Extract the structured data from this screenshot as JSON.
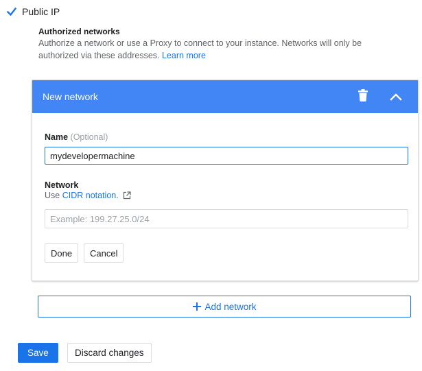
{
  "public_ip": {
    "label": "Public IP",
    "checked": true
  },
  "authorized_networks": {
    "title": "Authorized networks",
    "description": "Authorize a network or use a Proxy to connect to your instance. Networks will only be authorized via these addresses. ",
    "learn_more": "Learn more"
  },
  "network_card": {
    "title": "New network",
    "icons": {
      "delete": "trash-icon",
      "collapse": "chevron-up-icon"
    },
    "name_label": "Name",
    "name_optional": "(Optional)",
    "name_value": "mydevelopermachine",
    "network_label": "Network",
    "network_hint_prefix": "Use ",
    "network_hint_link": "CIDR notation.",
    "network_placeholder": "Example: 199.27.25.0/24",
    "done_label": "Done",
    "cancel_label": "Cancel"
  },
  "add_network": {
    "label": "Add network",
    "icon": "plus-icon"
  },
  "footer": {
    "save_label": "Save",
    "discard_label": "Discard changes"
  },
  "colors": {
    "accent": "#1a73e8",
    "header": "#4285f4",
    "border": "#dadce0",
    "muted_text": "#5f6368"
  }
}
